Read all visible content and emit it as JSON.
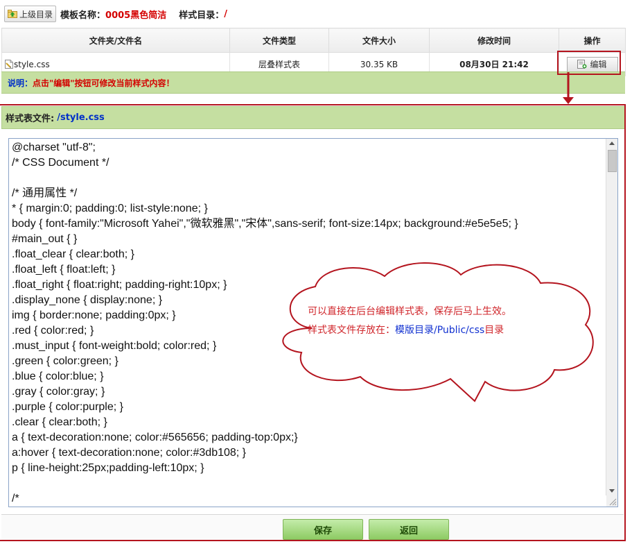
{
  "topbar": {
    "up_button": "上级目录",
    "template_name_label": "模板名称：",
    "template_name": "0005黑色简洁",
    "style_dir_label": "样式目录：",
    "style_dir": "/"
  },
  "file_table": {
    "headers": [
      "文件夹/文件名",
      "文件类型",
      "文件大小",
      "修改时间",
      "操作"
    ],
    "row": {
      "name": "style.css",
      "type": "层叠样式表",
      "size": "30.35 KB",
      "modified": "08月30日 21:42",
      "action": "编辑"
    }
  },
  "note": {
    "label": "说明：",
    "text": "点击\"编辑\"按钮可修改当前样式内容！"
  },
  "editor": {
    "file_label": "样式表文件:",
    "file_path": "/style.css",
    "content": "@charset \"utf-8\";\n/* CSS Document */\n\n/* 通用属性 */\n* { margin:0; padding:0; list-style:none; }\nbody { font-family:\"Microsoft Yahei\",\"微软雅黑\",\"宋体\",sans-serif; font-size:14px; background:#e5e5e5; }\n#main_out { }\n.float_clear { clear:both; }\n.float_left { float:left; }\n.float_right { float:right; padding-right:10px; }\n.display_none { display:none; }\nimg { border:none; padding:0px; }\n.red { color:red; }\n.must_input { font-weight:bold; color:red; }\n.green { color:green; }\n.blue { color:blue; }\n.gray { color:gray; }\n.purple { color:purple; }\n.clear { clear:both; }\na { text-decoration:none; color:#565656; padding-top:0px;}\na:hover { text-decoration:none; color:#3db108; }\np { line-height:25px;padding-left:10px; }\n\n/*"
  },
  "buttons": {
    "save": "保存",
    "back": "返回"
  },
  "callout": {
    "line1": "可以直接在后台编辑样式表，保存后马上生效。",
    "line2_prefix": "样式表文件存放在：",
    "line2_path": "模版目录/Public/css",
    "line2_suffix": "目录"
  },
  "colors": {
    "annotation_red": "#b4141e",
    "header_green": "#c5dfa1",
    "link_blue": "#0030c8",
    "alert_red": "#d40000"
  }
}
